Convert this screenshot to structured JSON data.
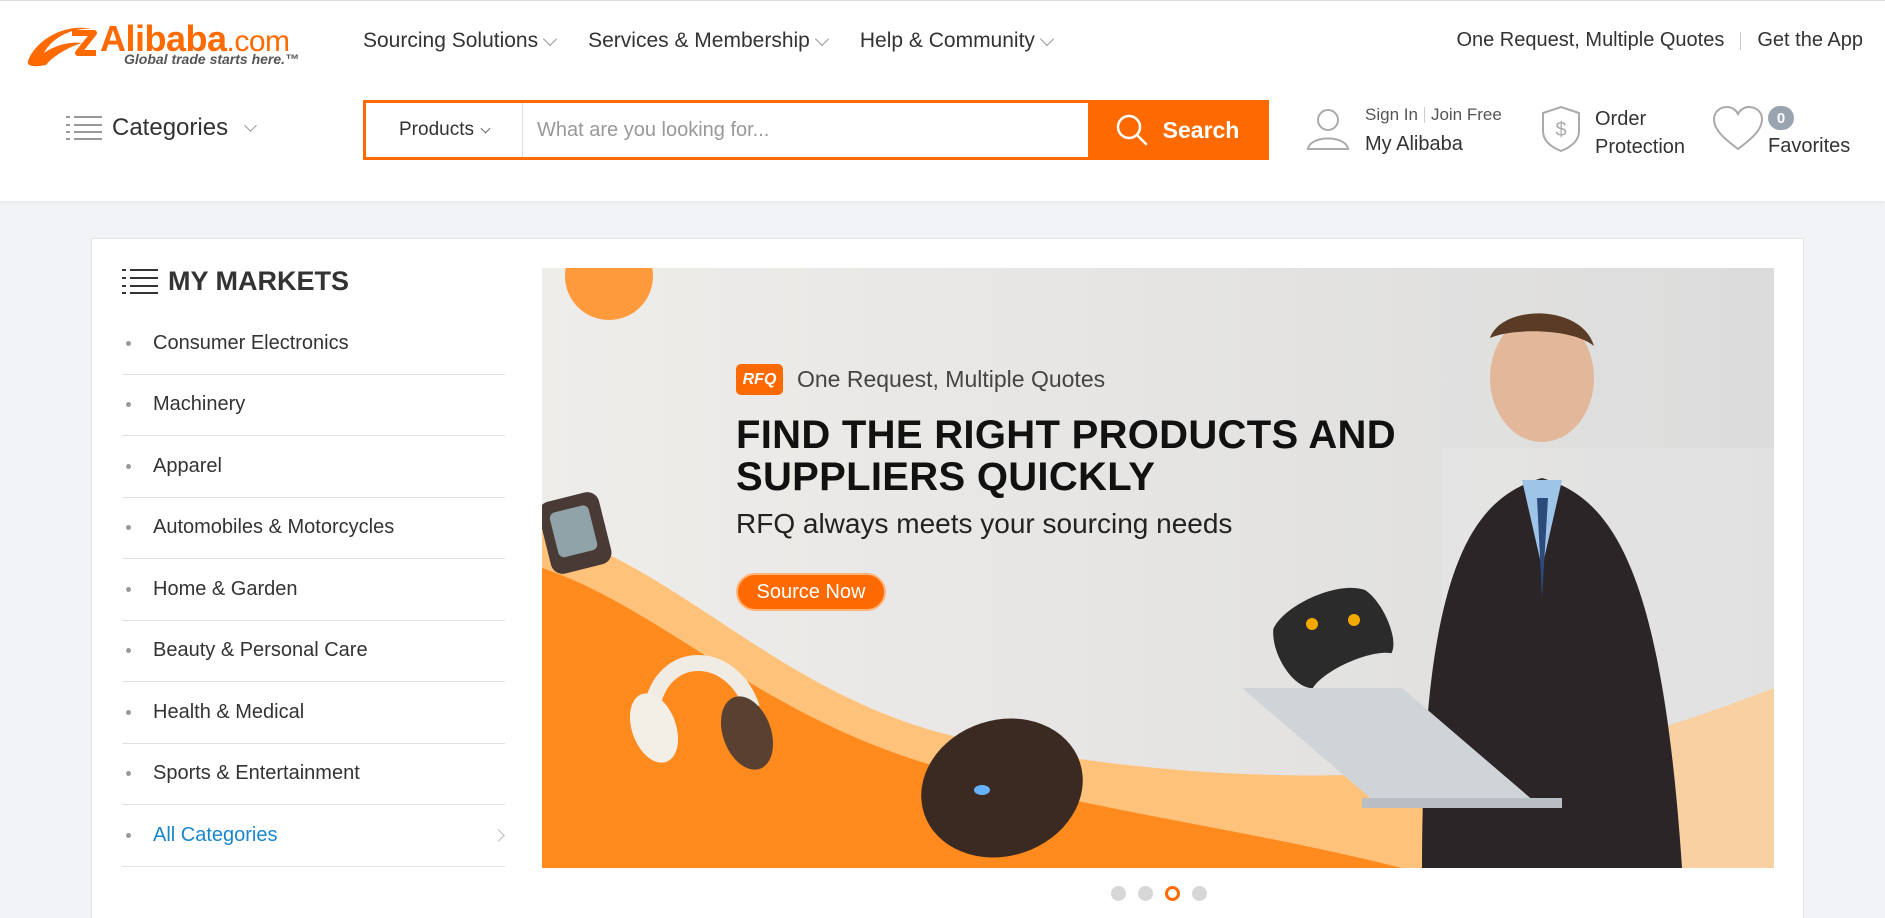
{
  "brand": {
    "name": "Alibaba",
    "domain": ".com",
    "tagline": "Global trade starts here.™",
    "accent_color": "#ff6a00"
  },
  "topnav": [
    {
      "label": "Sourcing Solutions"
    },
    {
      "label": "Services & Membership"
    },
    {
      "label": "Help & Community"
    }
  ],
  "toplinks": {
    "rfq": "One Request, Multiple Quotes",
    "app": "Get the App"
  },
  "categories": {
    "label": "Categories"
  },
  "search": {
    "category": "Products",
    "placeholder": "What are you looking for...",
    "button": "Search"
  },
  "account": {
    "sign_in": "Sign In",
    "join": "Join Free",
    "my_alibaba": "My Alibaba"
  },
  "order_protection": {
    "line1": "Order",
    "line2": "Protection"
  },
  "favorites": {
    "count": "0",
    "label": "Favorites"
  },
  "markets": {
    "title": "MY MARKETS",
    "items": [
      {
        "label": "Consumer Electronics"
      },
      {
        "label": "Machinery"
      },
      {
        "label": "Apparel"
      },
      {
        "label": "Automobiles & Motorcycles"
      },
      {
        "label": "Home & Garden"
      },
      {
        "label": "Beauty & Personal Care"
      },
      {
        "label": "Health & Medical"
      },
      {
        "label": "Sports & Entertainment"
      }
    ],
    "all": "All Categories"
  },
  "banner": {
    "badge": "RFQ",
    "tagline": "One Request, Multiple Quotes",
    "headline_line1": "FIND THE RIGHT PRODUCTS AND",
    "headline_line2": "SUPPLIERS QUICKLY",
    "subline": "RFQ always meets your sourcing needs",
    "cta": "Source Now"
  },
  "carousel": {
    "slides": 4,
    "active_index": 3
  }
}
